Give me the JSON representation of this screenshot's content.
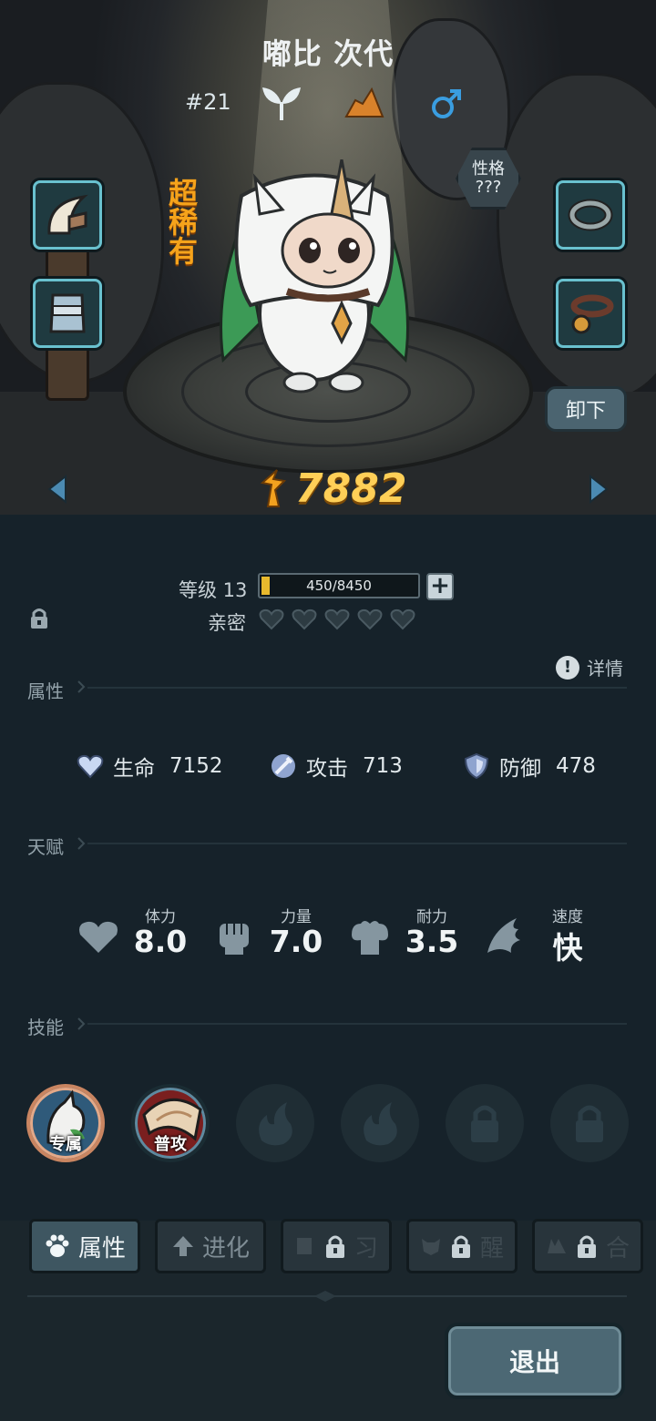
{
  "header": {
    "pet_name": "嘟比 次代",
    "pet_number": "#21",
    "element_icon": "sprout-icon",
    "terrain_icon": "rock-icon",
    "gender_icon": "male-symbol-icon",
    "rarity": "超稀有",
    "trait_label": "性格",
    "trait_value": "???"
  },
  "equipment": {
    "left": [
      "claw-item-icon",
      "armor-item-icon"
    ],
    "right": [
      "ring-item-icon",
      "collar-bell-item-icon"
    ],
    "unequip_label": "卸下"
  },
  "power": {
    "value": "7882",
    "icon": "power-icon"
  },
  "level": {
    "label": "等级 13",
    "xp_text": "450/8450",
    "xp_fraction": 0.053
  },
  "affection": {
    "label": "亲密",
    "hearts_total": 5,
    "hearts_filled": 0
  },
  "sections": {
    "attributes": "属性",
    "details": "详情",
    "talents": "天赋",
    "skills": "技能"
  },
  "attributes": [
    {
      "label": "生命",
      "value": "7152",
      "icon": "hp-heart-icon"
    },
    {
      "label": "攻击",
      "value": "713",
      "icon": "sword-icon"
    },
    {
      "label": "防御",
      "value": "478",
      "icon": "shield-icon"
    }
  ],
  "talents": [
    {
      "label": "体力",
      "value": "8.0",
      "icon": "heart-icon"
    },
    {
      "label": "力量",
      "value": "7.0",
      "icon": "fist-icon"
    },
    {
      "label": "耐力",
      "value": "3.5",
      "icon": "muscle-icon"
    },
    {
      "label": "速度",
      "value": "快",
      "icon": "wing-icon"
    }
  ],
  "skills": [
    {
      "tag": "专属",
      "state": "owned"
    },
    {
      "tag": "普攻",
      "state": "owned"
    },
    {
      "tag": "",
      "state": "empty"
    },
    {
      "tag": "",
      "state": "empty"
    },
    {
      "tag": "",
      "state": "locked"
    },
    {
      "tag": "",
      "state": "locked"
    }
  ],
  "tabs": [
    {
      "label": "属性",
      "state": "active"
    },
    {
      "label": "进化",
      "state": "normal"
    },
    {
      "label": "习",
      "state": "locked"
    },
    {
      "label": "醒",
      "state": "locked"
    },
    {
      "label": "合",
      "state": "locked"
    }
  ],
  "exit_label": "退出",
  "colors": {
    "accent_gold": "#ffcf57",
    "rarity_orange": "#f6a31b",
    "slot_border": "#69c1cf",
    "xp_fill": "#e8b92d"
  }
}
